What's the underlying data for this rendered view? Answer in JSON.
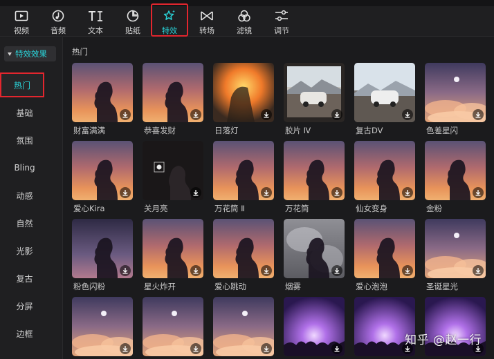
{
  "toolbar": {
    "items": [
      {
        "label": "视频",
        "icon": "video-icon"
      },
      {
        "label": "音频",
        "icon": "audio-icon"
      },
      {
        "label": "文本",
        "icon": "text-icon"
      },
      {
        "label": "贴纸",
        "icon": "sticker-icon"
      },
      {
        "label": "特效",
        "icon": "effects-star-icon"
      },
      {
        "label": "转场",
        "icon": "transition-icon"
      },
      {
        "label": "滤镜",
        "icon": "filter-icon"
      },
      {
        "label": "调节",
        "icon": "adjust-icon"
      }
    ],
    "active": "特效"
  },
  "sidebar": {
    "header": "特效效果",
    "items": [
      "热门",
      "基础",
      "氛围",
      "Bling",
      "动感",
      "自然",
      "光影",
      "复古",
      "分屏",
      "边框"
    ],
    "active": "热门"
  },
  "section": {
    "title": "热门"
  },
  "effects": [
    {
      "name": "财富满满",
      "bg": "sunset"
    },
    {
      "name": "恭喜发财",
      "bg": "sunset"
    },
    {
      "name": "日落灯",
      "bg": "glow"
    },
    {
      "name": "胶片 Ⅳ",
      "bg": "film"
    },
    {
      "name": "复古DV",
      "bg": "car"
    },
    {
      "name": "色差星闪",
      "bg": "clouds"
    },
    {
      "name": "爱心Kira",
      "bg": "sunset"
    },
    {
      "name": "关月亮",
      "bg": "dark"
    },
    {
      "name": "万花筒 Ⅱ",
      "bg": "sunset"
    },
    {
      "name": "万花筒",
      "bg": "sunset"
    },
    {
      "name": "仙女变身",
      "bg": "sunset"
    },
    {
      "name": "金粉",
      "bg": "sunset"
    },
    {
      "name": "粉色闪粉",
      "bg": "purple"
    },
    {
      "name": "星火炸开",
      "bg": "sunset"
    },
    {
      "name": "爱心跳动",
      "bg": "sunset"
    },
    {
      "name": "烟雾",
      "bg": "smoke"
    },
    {
      "name": "爱心泡泡",
      "bg": "sunset"
    },
    {
      "name": "圣诞星光",
      "bg": "clouds"
    },
    {
      "name": "",
      "bg": "clouds"
    },
    {
      "name": "",
      "bg": "clouds"
    },
    {
      "name": "",
      "bg": "clouds"
    },
    {
      "name": "",
      "bg": "concert"
    },
    {
      "name": "",
      "bg": "concert"
    },
    {
      "name": "",
      "bg": "concert"
    }
  ],
  "watermark": "知乎 @赵一行",
  "colors": {
    "accent": "#2ad3d8",
    "highlight_box": "#e3262e",
    "background": "#1b1b1d"
  }
}
